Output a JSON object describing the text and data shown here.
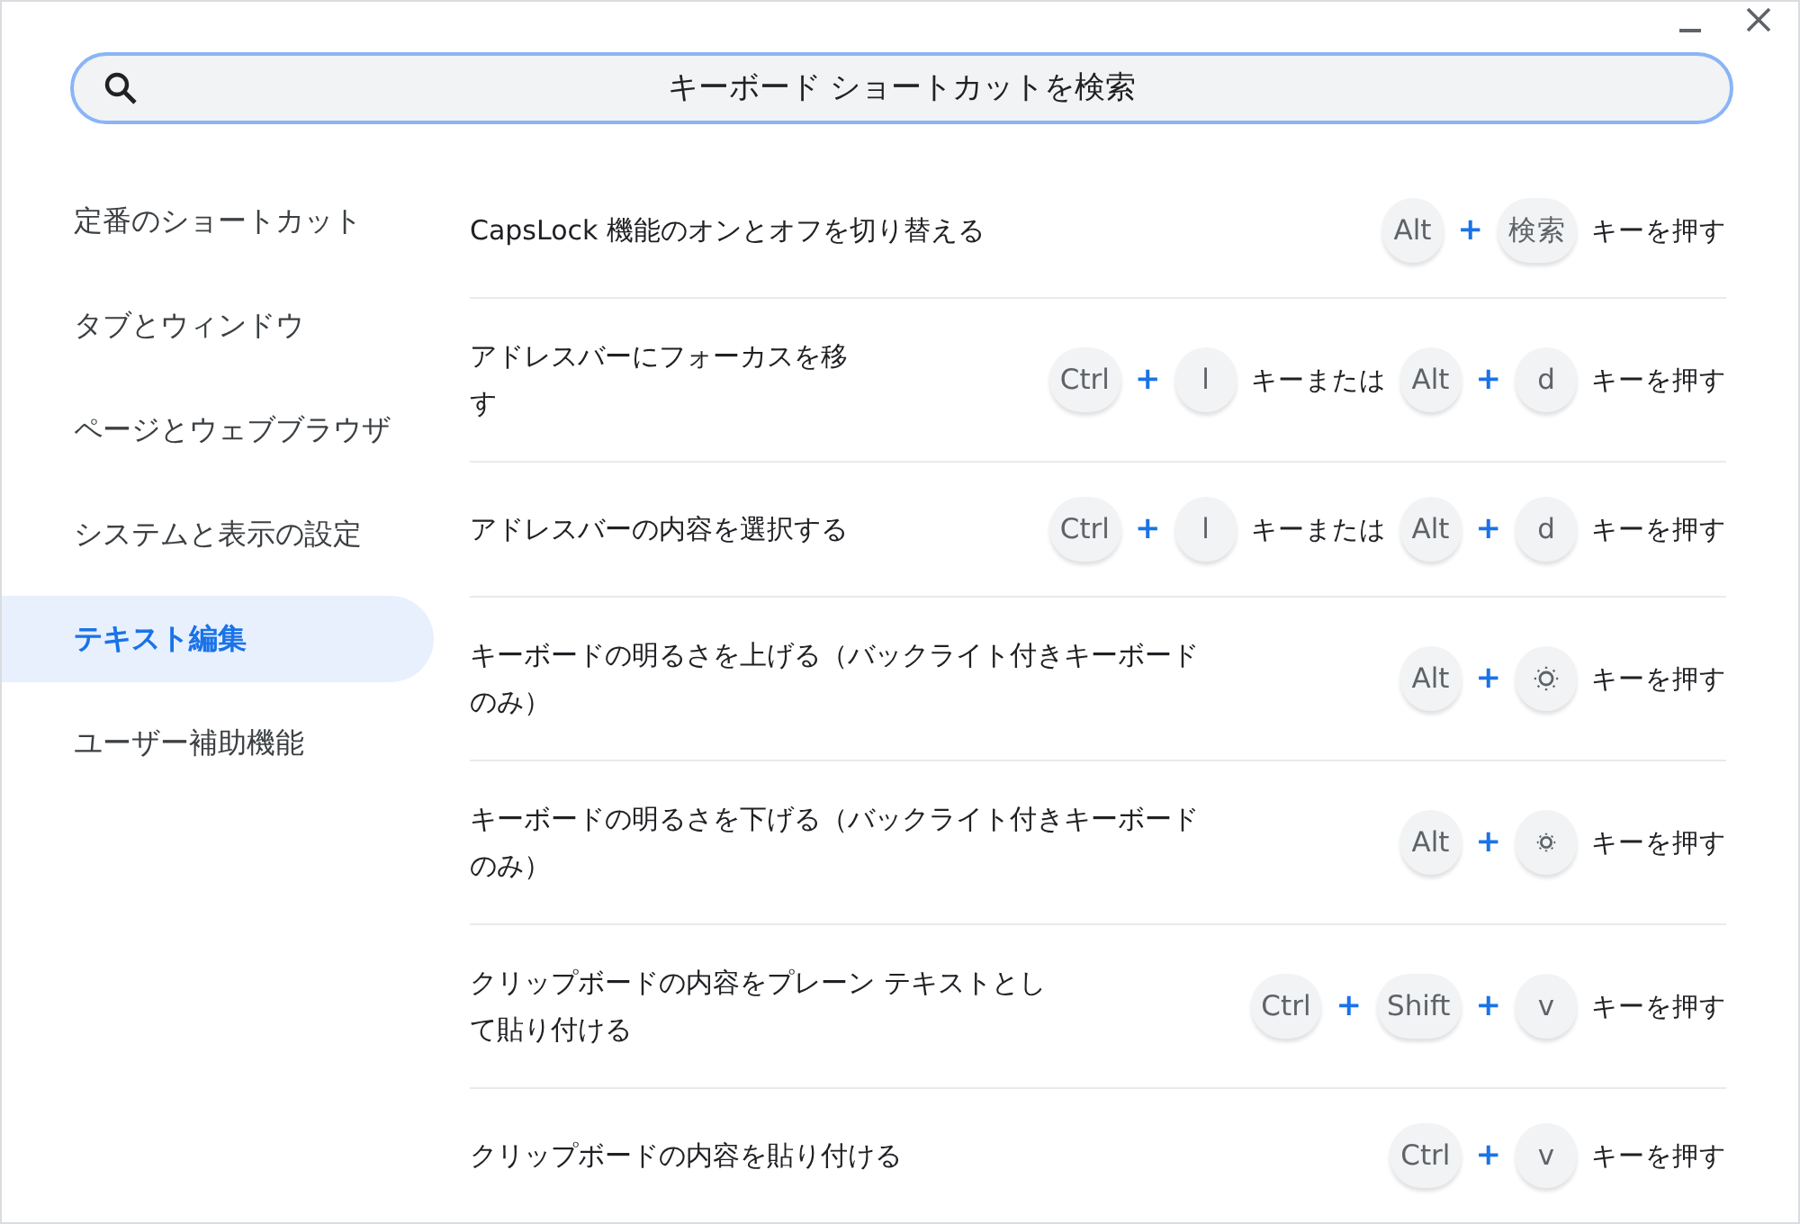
{
  "search": {
    "placeholder": "キーボード ショートカットを検索"
  },
  "sidebar": {
    "items": [
      {
        "label": "定番のショートカット",
        "selected": false
      },
      {
        "label": "タブとウィンドウ",
        "selected": false
      },
      {
        "label": "ページとウェブブラウザ",
        "selected": false
      },
      {
        "label": "システムと表示の設定",
        "selected": false
      },
      {
        "label": "テキスト編集",
        "selected": true
      },
      {
        "label": "ユーザー補助機能",
        "selected": false
      }
    ]
  },
  "shortcuts": [
    {
      "description": "CapsLock 機能のオンとオフを切り替える",
      "keys": [
        {
          "kind": "key",
          "text": "Alt"
        },
        {
          "kind": "plus",
          "text": "+"
        },
        {
          "kind": "key",
          "text": "検索"
        },
        {
          "kind": "text",
          "text": "キーを押す"
        }
      ]
    },
    {
      "description": "アドレスバーにフォーカスを移す",
      "keys": [
        {
          "kind": "key",
          "text": "Ctrl"
        },
        {
          "kind": "plus",
          "text": "+"
        },
        {
          "kind": "key",
          "text": "l"
        },
        {
          "kind": "text",
          "text": "キーまたは"
        },
        {
          "kind": "key",
          "text": "Alt"
        },
        {
          "kind": "plus",
          "text": "+"
        },
        {
          "kind": "key",
          "text": "d"
        },
        {
          "kind": "text",
          "text": "キーを押す"
        }
      ]
    },
    {
      "description": "アドレスバーの内容を選択する",
      "keys": [
        {
          "kind": "key",
          "text": "Ctrl"
        },
        {
          "kind": "plus",
          "text": "+"
        },
        {
          "kind": "key",
          "text": "l"
        },
        {
          "kind": "text",
          "text": "キーまたは"
        },
        {
          "kind": "key",
          "text": "Alt"
        },
        {
          "kind": "plus",
          "text": "+"
        },
        {
          "kind": "key",
          "text": "d"
        },
        {
          "kind": "text",
          "text": "キーを押す"
        }
      ]
    },
    {
      "description": "キーボードの明るさを上げる（バックライト付きキーボードのみ）",
      "keys": [
        {
          "kind": "key",
          "text": "Alt"
        },
        {
          "kind": "plus",
          "text": "+"
        },
        {
          "kind": "brightness-up"
        },
        {
          "kind": "text",
          "text": "キーを押す"
        }
      ]
    },
    {
      "description": "キーボードの明るさを下げる（バックライト付きキーボードのみ）",
      "keys": [
        {
          "kind": "key",
          "text": "Alt"
        },
        {
          "kind": "plus",
          "text": "+"
        },
        {
          "kind": "brightness-down"
        },
        {
          "kind": "text",
          "text": "キーを押す"
        }
      ]
    },
    {
      "description": "クリップボードの内容をプレーン テキストとして貼り付ける",
      "keys": [
        {
          "kind": "key",
          "text": "Ctrl"
        },
        {
          "kind": "plus",
          "text": "+"
        },
        {
          "kind": "key",
          "text": "Shift"
        },
        {
          "kind": "plus",
          "text": "+"
        },
        {
          "kind": "key",
          "text": "v"
        },
        {
          "kind": "text",
          "text": "キーを押す"
        }
      ]
    },
    {
      "description": "クリップボードの内容を貼り付ける",
      "keys": [
        {
          "kind": "key",
          "text": "Ctrl"
        },
        {
          "kind": "plus",
          "text": "+"
        },
        {
          "kind": "key",
          "text": "v"
        },
        {
          "kind": "text",
          "text": "キーを押す"
        }
      ]
    }
  ]
}
